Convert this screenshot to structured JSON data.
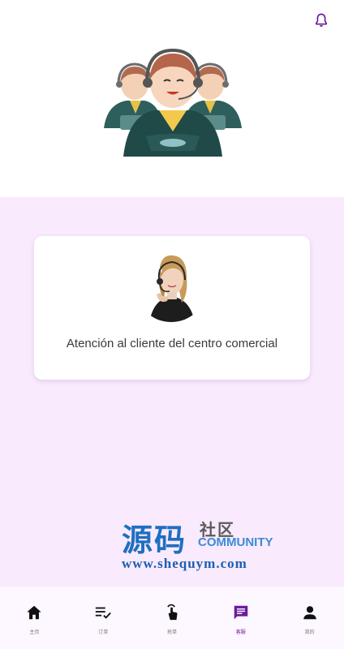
{
  "colors": {
    "accent": "#6a1b9a",
    "page_bg": "#f9eafd",
    "card_bg": "#ffffff",
    "nav_bg": "#fdf7ff"
  },
  "header": {
    "notification_icon": "bell-icon"
  },
  "hero": {
    "illustration": "customer-service-agents-illustration"
  },
  "card": {
    "title": "Atención al cliente del centro comercial",
    "avatar": "customer-service-agent-photo"
  },
  "watermark": {
    "cn_main": "源码",
    "cn_sub": "社区",
    "en": "COMMUNITY",
    "url": "www.shequym.com"
  },
  "nav": {
    "active_index": 3,
    "items": [
      {
        "label": "主页",
        "icon": "home-icon"
      },
      {
        "label": "订单",
        "icon": "orders-icon"
      },
      {
        "label": "抢单",
        "icon": "grab-order-icon"
      },
      {
        "label": "客服",
        "icon": "chat-icon"
      },
      {
        "label": "我的",
        "icon": "profile-icon"
      }
    ]
  }
}
